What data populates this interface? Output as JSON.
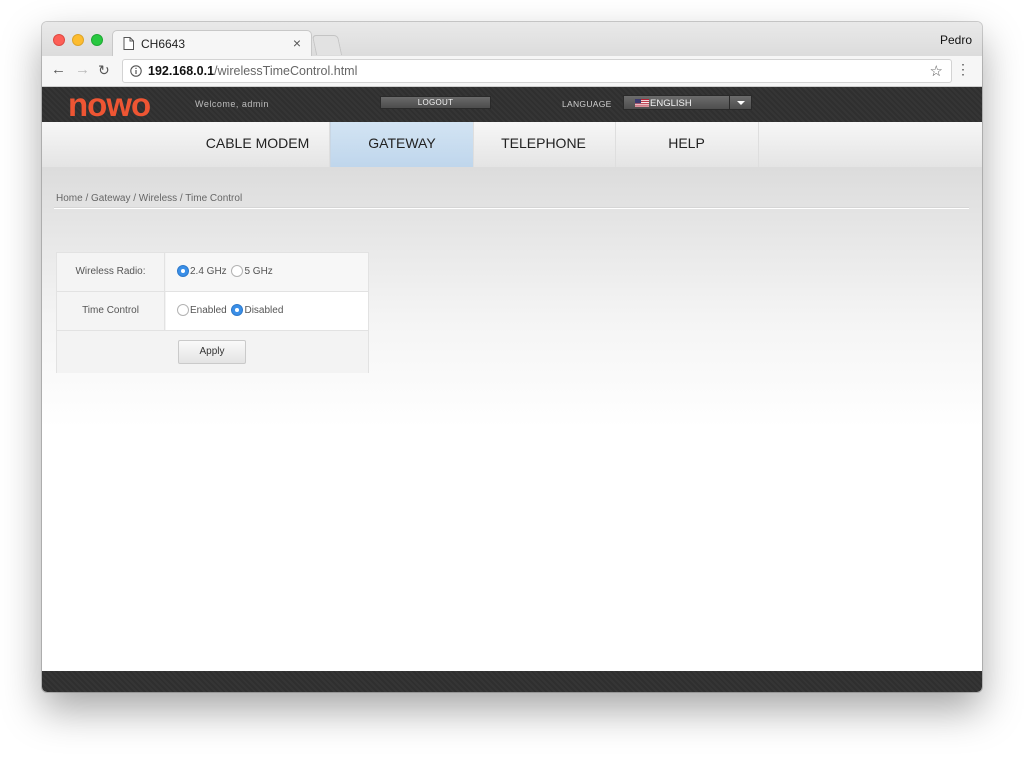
{
  "browser": {
    "tab_title": "CH6643",
    "tab_close": "×",
    "profile_name": "Pedro",
    "url_host": "192.168.0.1",
    "url_path": "/wirelessTimeControl.html",
    "icons": [
      "back-arrow-icon",
      "forward-arrow-icon",
      "reload-icon",
      "info-icon",
      "star-icon",
      "menu-icon",
      "page-icon"
    ]
  },
  "router": {
    "logo": "nowo",
    "welcome": "Welcome, admin",
    "logout_label": "LOGOUT",
    "language_label": "LANGUAGE",
    "language_value": "ENGLISH",
    "brand_color": "#ee5533"
  },
  "nav": {
    "items": [
      {
        "label": "CABLE MODEM",
        "active": false
      },
      {
        "label": "GATEWAY",
        "active": true
      },
      {
        "label": "TELEPHONE",
        "active": false
      },
      {
        "label": "HELP",
        "active": false
      }
    ]
  },
  "breadcrumb": "Home / Gateway / Wireless / Time Control",
  "form": {
    "wireless_radio": {
      "label": "Wireless Radio:",
      "options": [
        "2.4 GHz",
        "5 GHz"
      ],
      "selected": "2.4 GHz"
    },
    "time_control": {
      "label": "Time Control",
      "options": [
        "Enabled",
        "Disabled"
      ],
      "selected": "Disabled"
    },
    "apply_label": "Apply"
  }
}
